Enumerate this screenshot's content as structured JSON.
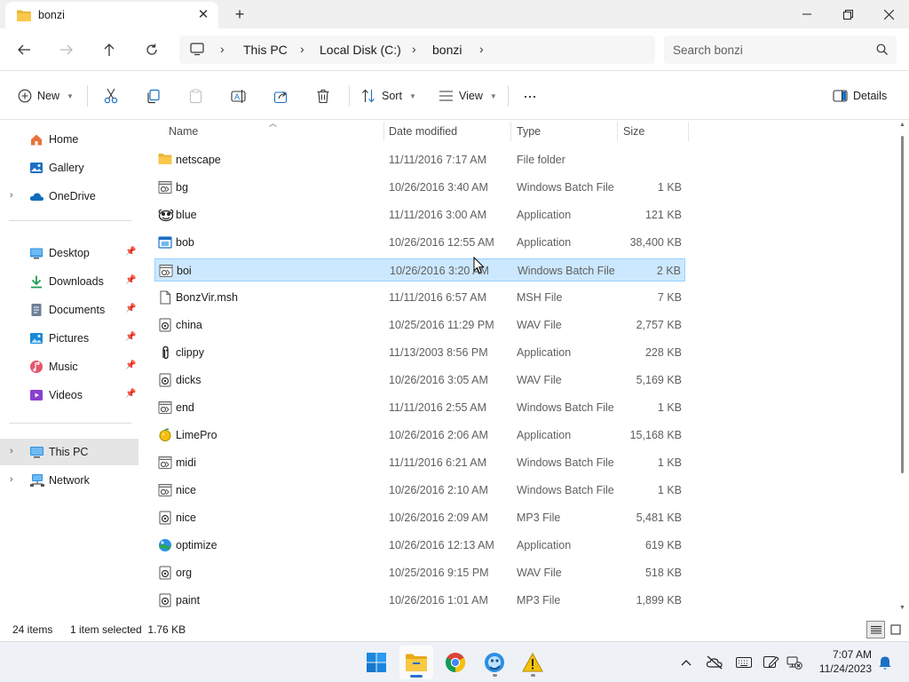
{
  "tab": {
    "title": "bonzi",
    "close_symbol": "✕",
    "new_symbol": "+"
  },
  "address": {
    "breadcrumbs": [
      "This PC",
      "Local Disk (C:)",
      "bonzi"
    ],
    "separator": "›"
  },
  "search": {
    "placeholder": "Search bonzi"
  },
  "commands": {
    "new_label": "New",
    "sort_label": "Sort",
    "view_label": "View",
    "more_label": "···",
    "details_label": "Details"
  },
  "sidebar": {
    "items": [
      {
        "label": "Home",
        "icon": "home-icon"
      },
      {
        "label": "Gallery",
        "icon": "gallery-icon"
      },
      {
        "label": "OneDrive",
        "icon": "cloud-icon"
      },
      {
        "label": "Desktop",
        "icon": "desktop-icon"
      },
      {
        "label": "Downloads",
        "icon": "download-icon"
      },
      {
        "label": "Documents",
        "icon": "documents-icon"
      },
      {
        "label": "Pictures",
        "icon": "pictures-icon"
      },
      {
        "label": "Music",
        "icon": "music-icon"
      },
      {
        "label": "Videos",
        "icon": "videos-icon"
      },
      {
        "label": "This PC",
        "icon": "pc-icon"
      },
      {
        "label": "Network",
        "icon": "network-icon"
      }
    ]
  },
  "columns": {
    "name": "Name",
    "date": "Date modified",
    "type": "Type",
    "size": "Size"
  },
  "files": [
    {
      "name": "netscape",
      "date": "11/11/2016 7:17 AM",
      "type": "File folder",
      "size": "",
      "icon": "folder-icon"
    },
    {
      "name": "bg",
      "date": "10/26/2016 3:40 AM",
      "type": "Windows Batch File",
      "size": "1 KB",
      "icon": "batch-file-icon"
    },
    {
      "name": "blue",
      "date": "11/11/2016 3:00 AM",
      "type": "Application",
      "size": "121 KB",
      "icon": "app-icon"
    },
    {
      "name": "bob",
      "date": "10/26/2016 12:55 AM",
      "type": "Application",
      "size": "38,400 KB",
      "icon": "app-window-icon"
    },
    {
      "name": "boi",
      "date": "10/26/2016 3:20 AM",
      "type": "Windows Batch File",
      "size": "2 KB",
      "icon": "batch-file-icon",
      "selected": true
    },
    {
      "name": "BonzVir.msh",
      "date": "11/11/2016 6:57 AM",
      "type": "MSH File",
      "size": "7 KB",
      "icon": "blank-file-icon"
    },
    {
      "name": "china",
      "date": "10/25/2016 11:29 PM",
      "type": "WAV File",
      "size": "2,757 KB",
      "icon": "audio-file-icon"
    },
    {
      "name": "clippy",
      "date": "11/13/2003 8:56 PM",
      "type": "Application",
      "size": "228 KB",
      "icon": "clippy-icon"
    },
    {
      "name": "dicks",
      "date": "10/26/2016 3:05 AM",
      "type": "WAV File",
      "size": "5,169 KB",
      "icon": "audio-file-icon"
    },
    {
      "name": "end",
      "date": "11/11/2016 2:55 AM",
      "type": "Windows Batch File",
      "size": "1 KB",
      "icon": "batch-file-icon"
    },
    {
      "name": "LimePro",
      "date": "10/26/2016 2:06 AM",
      "type": "Application",
      "size": "15,168 KB",
      "icon": "limepro-icon"
    },
    {
      "name": "midi",
      "date": "11/11/2016 6:21 AM",
      "type": "Windows Batch File",
      "size": "1 KB",
      "icon": "batch-file-icon"
    },
    {
      "name": "nice",
      "date": "10/26/2016 2:10 AM",
      "type": "Windows Batch File",
      "size": "1 KB",
      "icon": "batch-file-icon"
    },
    {
      "name": "nice",
      "date": "10/26/2016 2:09 AM",
      "type": "MP3 File",
      "size": "5,481 KB",
      "icon": "audio-file-icon"
    },
    {
      "name": "optimize",
      "date": "10/26/2016 12:13 AM",
      "type": "Application",
      "size": "619 KB",
      "icon": "optimize-icon"
    },
    {
      "name": "org",
      "date": "10/25/2016 9:15 PM",
      "type": "WAV File",
      "size": "518 KB",
      "icon": "audio-file-icon"
    },
    {
      "name": "paint",
      "date": "10/26/2016 1:01 AM",
      "type": "MP3 File",
      "size": "1,899 KB",
      "icon": "audio-file-icon"
    }
  ],
  "status": {
    "item_count": "24 items",
    "selection": "1 item selected  1.76 KB"
  },
  "taskbar": {
    "apps": [
      "start-icon",
      "file-explorer-icon",
      "chrome-icon",
      "bonzi-app-icon",
      "warning-app-icon"
    ],
    "time": "7:07 AM",
    "date": "11/24/2023"
  },
  "colors": {
    "selection_bg": "#cce8ff",
    "selection_border": "#99d1ff",
    "accent": "#0067c0",
    "folder": "#f8c84b"
  }
}
